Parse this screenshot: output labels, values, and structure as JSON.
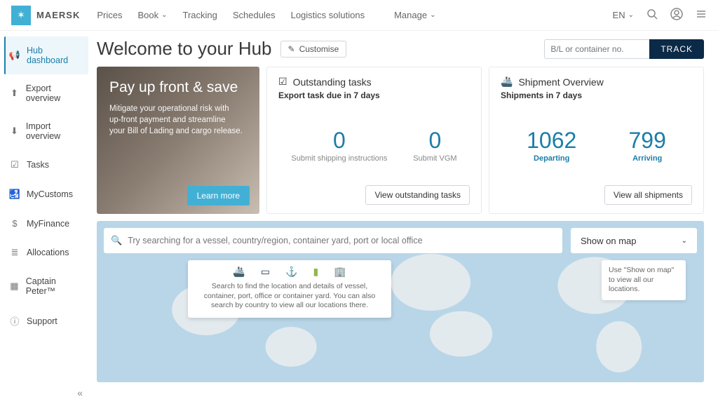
{
  "brand": {
    "name": "MAERSK"
  },
  "nav": {
    "items": [
      "Prices",
      "Book",
      "Tracking",
      "Schedules",
      "Logistics solutions",
      "Manage"
    ],
    "dropdown": [
      false,
      true,
      false,
      false,
      false,
      true
    ],
    "lang": "EN"
  },
  "sidebar": {
    "items": [
      {
        "label": "Hub dashboard",
        "icon": "📢"
      },
      {
        "label": "Export overview",
        "icon": "⬆"
      },
      {
        "label": "Import overview",
        "icon": "⬇"
      },
      {
        "label": "Tasks",
        "icon": "☑"
      },
      {
        "label": "MyCustoms",
        "icon": "🛃"
      },
      {
        "label": "MyFinance",
        "icon": "$"
      },
      {
        "label": "Allocations",
        "icon": "≣"
      },
      {
        "label": "Captain Peter™",
        "icon": "▦"
      },
      {
        "label": "Support",
        "icon": "ⓘ"
      }
    ]
  },
  "header": {
    "title": "Welcome to your Hub",
    "customise": "Customise"
  },
  "track": {
    "placeholder": "B/L or container no.",
    "button": "TRACK"
  },
  "promo": {
    "title": "Pay up front & save",
    "body": "Mitigate your operational risk with up-front payment and streamline your Bill of Lading and cargo release.",
    "cta": "Learn more"
  },
  "tasks": {
    "title": "Outstanding tasks",
    "subtitle": "Export task due in 7 days",
    "stats": [
      {
        "value": "0",
        "label": "Submit shipping instructions"
      },
      {
        "value": "0",
        "label": "Submit VGM"
      }
    ],
    "button": "View outstanding tasks"
  },
  "overview": {
    "title": "Shipment Overview",
    "subtitle": "Shipments in 7 days",
    "stats": [
      {
        "value": "1062",
        "label": "Departing"
      },
      {
        "value": "799",
        "label": "Arriving"
      }
    ],
    "button": "View all shipments"
  },
  "map": {
    "search_placeholder": "Try searching for a vessel, country/region, container yard, port or local office",
    "select": "Show on map",
    "tip": "Search to find the location and details of vessel, container, port, office or container yard. You can also search by country to view all our locations there.",
    "hint": "Use \"Show on map\" to view all our locations."
  }
}
